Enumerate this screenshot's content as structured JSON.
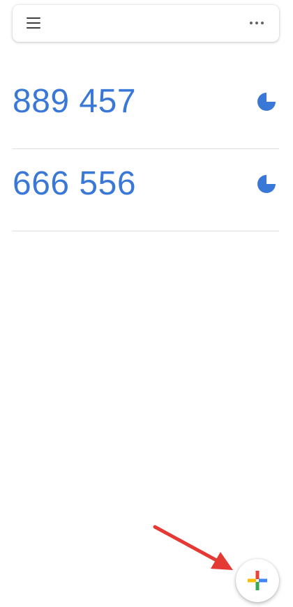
{
  "app_bar": {
    "title": "",
    "menu_icon": "hamburger-menu-icon",
    "more_icon": "more-horizontal-icon"
  },
  "codes": [
    {
      "account": "",
      "code": "889 457",
      "timer_fraction_remaining": 0.75
    },
    {
      "account": "",
      "code": "666 556",
      "timer_fraction_remaining": 0.75
    }
  ],
  "fab": {
    "icon": "add-plus-icon",
    "colors": {
      "top": "#EA4335",
      "right": "#4285F4",
      "bottom": "#34A853",
      "left": "#FBBC05"
    }
  },
  "annotation": {
    "color": "#E53935",
    "icon": "pointer-arrow-icon"
  },
  "theme": {
    "code_color": "#3A78D8",
    "divider_color": "#DADCE0"
  }
}
